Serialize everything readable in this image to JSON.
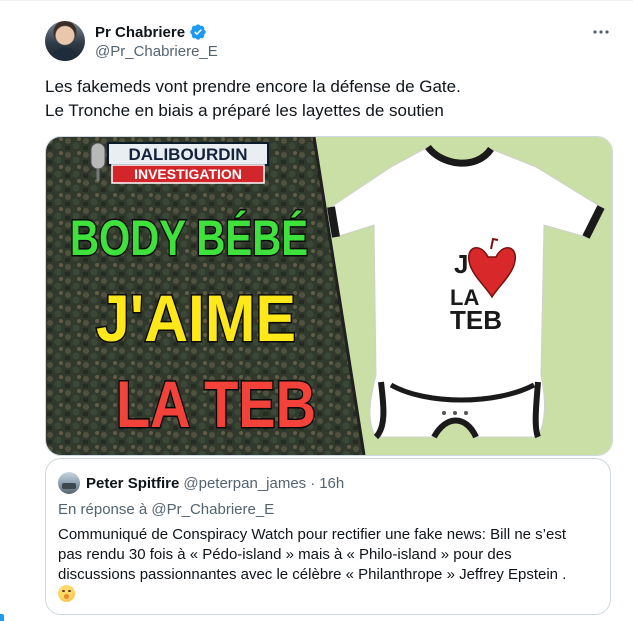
{
  "author": {
    "name": "Pr Chabriere",
    "handle": "@Pr_Chabriere_E",
    "verified": true
  },
  "tweet": {
    "lines": [
      "Les fakemeds vont prendre encore la défense de Gate.",
      "Le Tronche en biais a préparé les layettes de soutien"
    ]
  },
  "media": {
    "banner_top": "DALIBOURDIN",
    "banner_bottom": "INVESTIGATION",
    "headline_1": "BODY BÉBÉ",
    "headline_2": "J'AIME",
    "headline_3": "LA TEB",
    "onesie_line_1": "J'",
    "onesie_line_2": "LA",
    "onesie_line_3": "TEB"
  },
  "quote": {
    "name": "Peter Spitfire",
    "handle": "@peterpan_james",
    "separator": "·",
    "time": "16h",
    "reply_prefix": "En réponse à",
    "reply_to": "@Pr_Chabriere_E",
    "body_lines": [
      "Communiqué de Conspiracy Watch pour rectifier une fake news: Bill ne s’est",
      "pas rendu 30 fois à « Pédo-island » mais à « Philo-island » pour des",
      "discussions passionnantes avec le célèbre « Philanthrope » Jeffrey Epstein ."
    ]
  },
  "colors": {
    "verified_blue": "#1d9bf0",
    "secondary_text": "#536471",
    "border": "#cfd9de",
    "headline_green": "#3fe23c",
    "headline_yellow": "#ffe81a",
    "headline_red": "#f2423a",
    "banner_red": "#d3262a",
    "panel_green": "#c9dfa6"
  },
  "icons": [
    "verified-badge-icon",
    "more-options-icon",
    "heart-icon",
    "microphone-icon",
    "emoji-shush-icon"
  ]
}
